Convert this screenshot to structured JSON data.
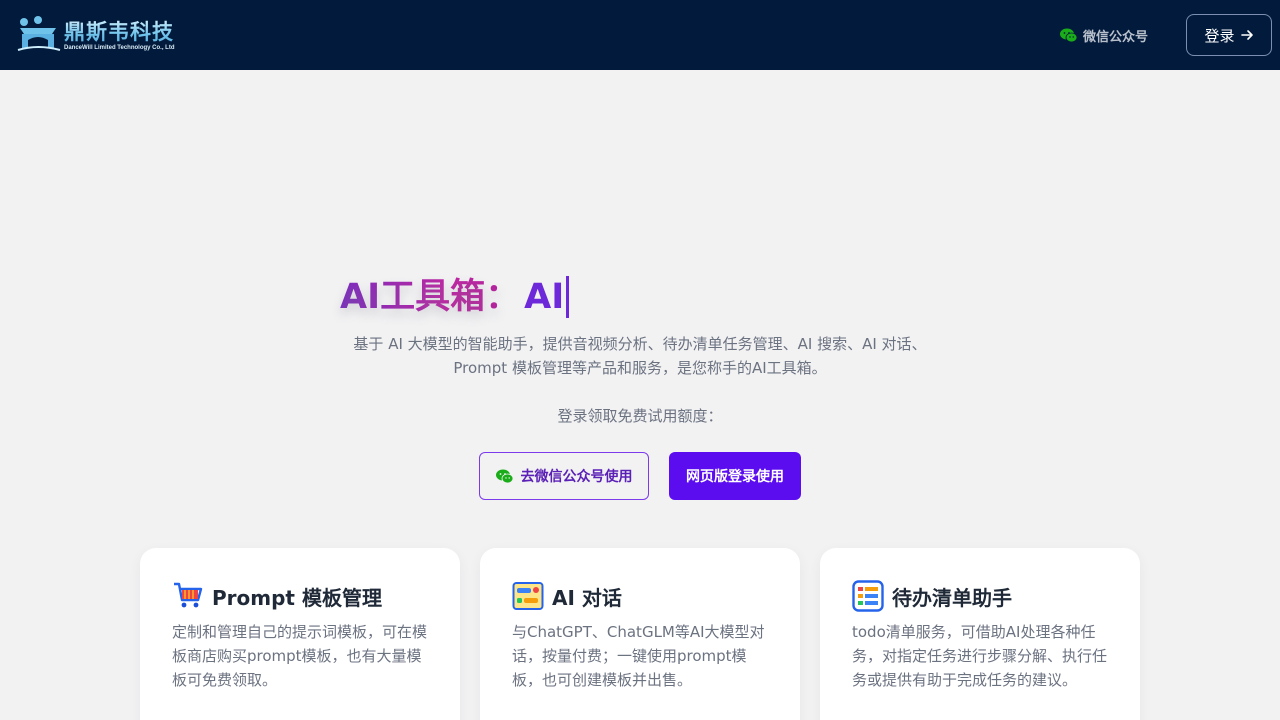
{
  "header": {
    "logo_cn": "鼎斯韦科技",
    "logo_en": "DanceWill Limited Technology Co., Ltd",
    "wechat_label": "微信公众号",
    "login_label": "登录"
  },
  "hero": {
    "title_static": "AI工具箱：",
    "title_dynamic": "AI",
    "description": "基于 AI 大模型的智能助手，提供音视频分析、待办清单任务管理、AI 搜索、AI 对话、Prompt 模板管理等产品和服务，是您称手的AI工具箱。",
    "note": "登录领取免费试用额度：",
    "btn_wechat": "去微信公众号使用",
    "btn_web": "网页版登录使用"
  },
  "cards": [
    {
      "icon": "shopping-cart-icon",
      "title": "Prompt 模板管理",
      "text": "定制和管理自己的提示词模板，可在模板商店购买prompt模板，也有大量模板可免费领取。"
    },
    {
      "icon": "chat-window-icon",
      "title": "AI 对话",
      "text": "与ChatGPT、ChatGLM等AI大模型对话，按量付费；一键使用prompt模板，也可创建模板并出售。"
    },
    {
      "icon": "checklist-icon",
      "title": "待办清单助手",
      "text": "todo清单服务，可借助AI处理各种任务，对指定任务进行步骤分解、执行任务或提供有助于完成任务的建议。"
    }
  ],
  "colors": {
    "header_bg": "#021a3b",
    "accent": "#5b0df0",
    "wechat_green": "#1aad19"
  }
}
